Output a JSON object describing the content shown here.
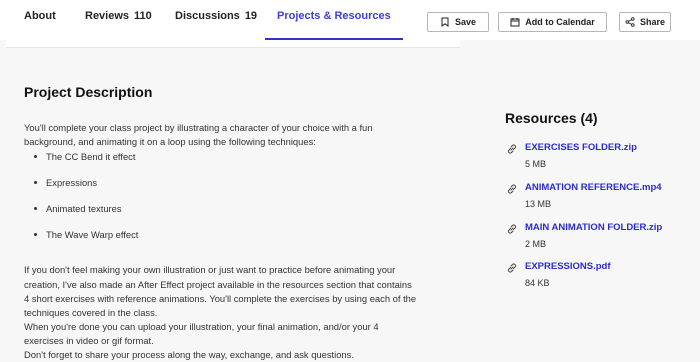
{
  "tabs": [
    {
      "label": "About",
      "count": ""
    },
    {
      "label": "Reviews",
      "count": "110"
    },
    {
      "label": "Discussions",
      "count": "19"
    },
    {
      "label": "Projects & Resources",
      "count": ""
    }
  ],
  "actions": {
    "save": "Save",
    "calendar": "Add to Calendar",
    "share": "Share"
  },
  "project": {
    "title": "Project Description",
    "intro": [
      "You'll complete your class project by illustrating a character of your choice with a fun",
      "background, and animating it on a loop using the following techniques:"
    ],
    "bullets": [
      "The CC Bend it effect",
      "Expressions",
      "Animated textures",
      "The Wave Warp effect"
    ],
    "body": [
      "If you don't feel making your own illustration or just want to practice before animating your",
      "creation, I've also made an After Effect project available in the resources section that contains",
      "4 short exercises with reference animations. You'll complete the exercises by using each of the",
      "techniques covered in the class.",
      "When you're done you can upload your illustration, your final animation, and/or your 4",
      "exercises in video or gif format.",
      "Don't forget to share your process along the way, exchange, and ask questions."
    ]
  },
  "resources": {
    "title": "Resources (4)",
    "items": [
      {
        "name": "EXERCISES FOLDER.zip",
        "size": "5 MB"
      },
      {
        "name": "ANIMATION REFERENCE.mp4",
        "size": "13 MB"
      },
      {
        "name": "MAIN ANIMATION FOLDER.zip",
        "size": "2 MB"
      },
      {
        "name": "EXPRESSIONS.pdf",
        "size": "84 KB"
      }
    ]
  },
  "colors": {
    "accent": "#2f33c8",
    "link": "#2a2cd0",
    "background": "#f7f7f7"
  }
}
